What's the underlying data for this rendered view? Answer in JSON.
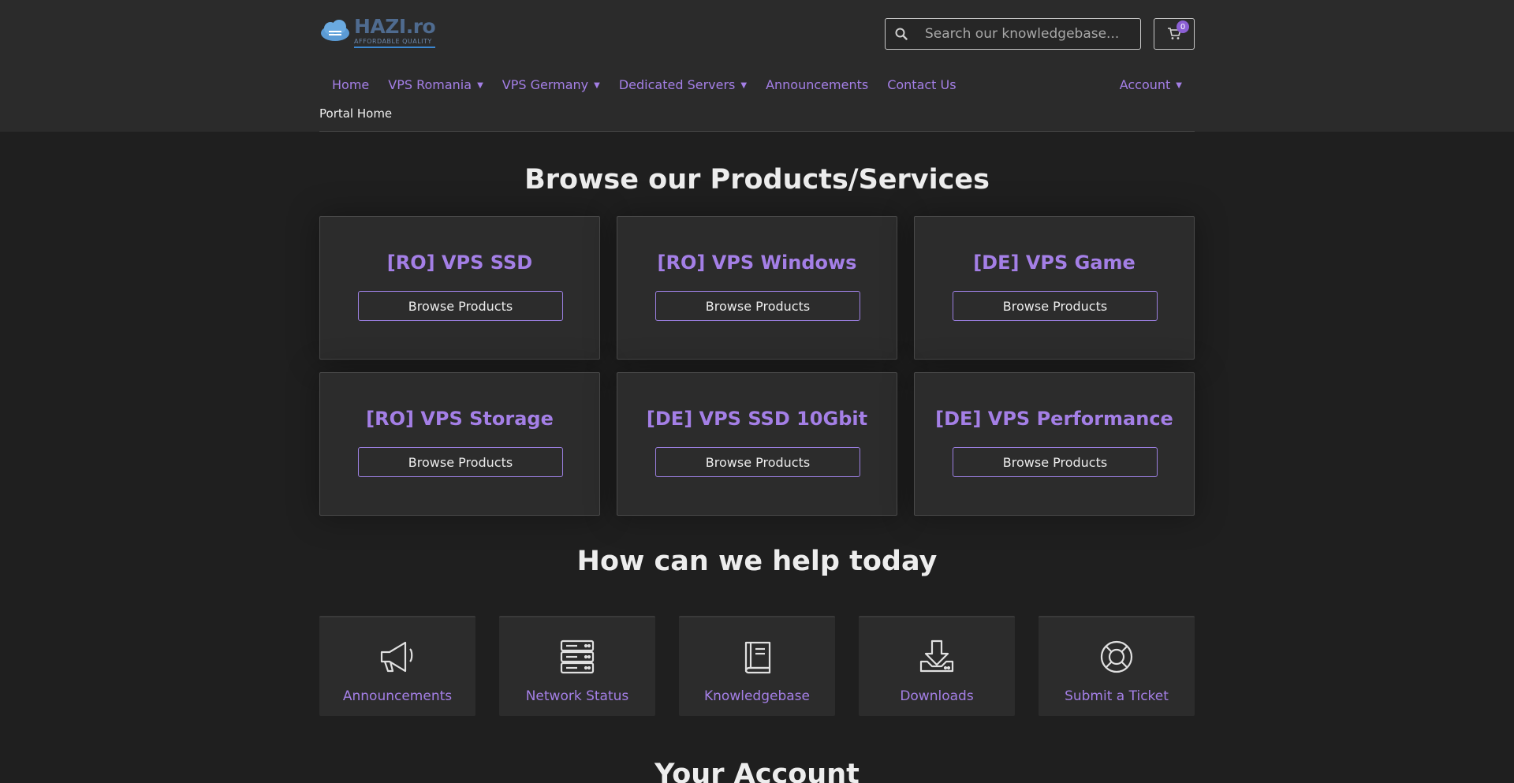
{
  "brand": {
    "name": "HAZI.ro",
    "tagline": "AFFORDABLE QUALITY"
  },
  "search": {
    "placeholder": "Search our knowledgebase..."
  },
  "cart": {
    "count": "0"
  },
  "nav": {
    "items": [
      {
        "label": "Home",
        "dropdown": false
      },
      {
        "label": "VPS Romania",
        "dropdown": true
      },
      {
        "label": "VPS Germany",
        "dropdown": true
      },
      {
        "label": "Dedicated Servers",
        "dropdown": true
      },
      {
        "label": "Announcements",
        "dropdown": false
      },
      {
        "label": "Contact Us",
        "dropdown": false
      }
    ],
    "account_label": "Account"
  },
  "breadcrumb": "Portal Home",
  "products": {
    "heading": "Browse our Products/Services",
    "button_label": "Browse Products",
    "items": [
      {
        "title": "[RO] VPS SSD"
      },
      {
        "title": "[RO] VPS Windows"
      },
      {
        "title": "[DE] VPS Game"
      },
      {
        "title": "[RO] VPS Storage"
      },
      {
        "title": "[DE] VPS SSD 10Gbit"
      },
      {
        "title": "[DE] VPS Performance"
      }
    ]
  },
  "help": {
    "heading": "How can we help today",
    "items": [
      {
        "label": "Announcements",
        "icon": "megaphone-icon"
      },
      {
        "label": "Network Status",
        "icon": "server-icon"
      },
      {
        "label": "Knowledgebase",
        "icon": "book-icon"
      },
      {
        "label": "Downloads",
        "icon": "download-icon"
      },
      {
        "label": "Submit a Ticket",
        "icon": "lifebuoy-icon"
      }
    ]
  },
  "account_section": {
    "heading": "Your Account"
  },
  "colors": {
    "accent": "#a47fe6",
    "background": "#1f1f1f",
    "header": "#2b2b2b",
    "card": "#2c2c2c"
  }
}
